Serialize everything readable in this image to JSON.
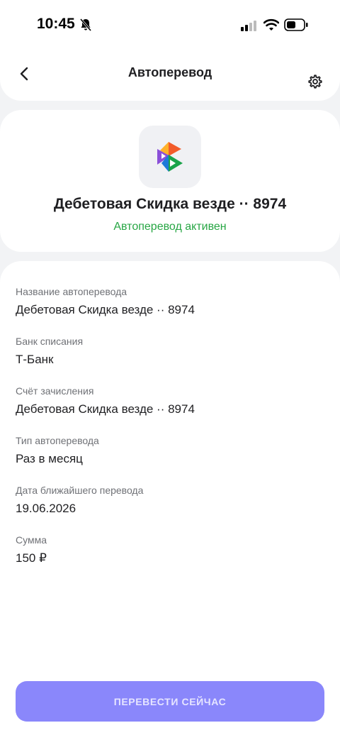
{
  "status_bar": {
    "time": "10:45",
    "icons": [
      "bell-off-icon",
      "signal-icon",
      "wifi-icon",
      "battery-icon"
    ]
  },
  "header": {
    "title": "Автоперевод",
    "back_icon": "chevron-left-icon",
    "settings_icon": "gear-icon"
  },
  "account": {
    "logo_icon": "bank-logo-icon",
    "title": "Дебетовая Скидка везде ·· 8974",
    "status": "Автоперевод активен",
    "status_color": "#27a644"
  },
  "details": [
    {
      "label": "Название автоперевода",
      "value": "Дебетовая Скидка везде ·· 8974"
    },
    {
      "label": "Банк списания",
      "value": "Т-Банк"
    },
    {
      "label": "Счёт зачисления",
      "value": "Дебетовая Скидка везде ·· 8974"
    },
    {
      "label": "Тип автоперевода",
      "value": "Раз в месяц"
    },
    {
      "label": "Дата ближайшего перевода",
      "value": "19.06.2026"
    },
    {
      "label": "Сумма",
      "value": "150 ₽"
    }
  ],
  "action": {
    "label": "ПЕРЕВЕСТИ СЕЙЧАС",
    "color": "#8a87fb"
  }
}
